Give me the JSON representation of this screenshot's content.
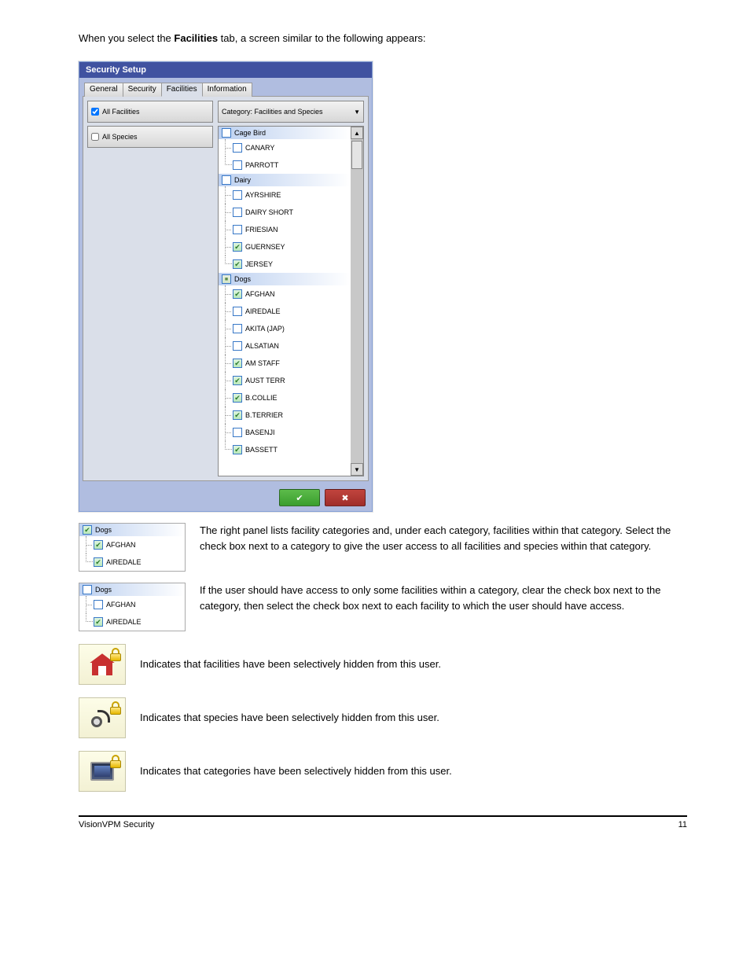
{
  "intro": {
    "part1": "When you select the ",
    "bold": "Facilities",
    "part2": " tab, a screen similar to the following appears:"
  },
  "dialog": {
    "title": "Security Setup",
    "tabs": [
      "General",
      "Security",
      "Facilities",
      "Information"
    ],
    "activeTab": 2,
    "leftFields": [
      {
        "label": "All Facilities",
        "checked": true
      },
      {
        "label": "All Species",
        "checked": false
      }
    ],
    "dropdown": "Category: Facilities and Species",
    "treeGroups": [
      {
        "header": "Cage Bird",
        "checked": false,
        "items": [
          {
            "label": "CANARY",
            "checked": false
          },
          {
            "label": "PARROTT",
            "checked": false
          }
        ]
      },
      {
        "header": "Dairy",
        "checked": false,
        "items": [
          {
            "label": "AYRSHIRE",
            "checked": false
          },
          {
            "label": "DAIRY SHORT",
            "checked": false
          },
          {
            "label": "FRIESIAN",
            "checked": false
          },
          {
            "label": "GUERNSEY",
            "checked": true
          },
          {
            "label": "JERSEY",
            "checked": true
          }
        ]
      },
      {
        "header": "Dogs",
        "checked": "mixed",
        "items": [
          {
            "label": "AFGHAN",
            "checked": true
          },
          {
            "label": "AIREDALE",
            "checked": false
          },
          {
            "label": "AKITA (JAP)",
            "checked": false
          },
          {
            "label": "ALSATIAN",
            "checked": false
          },
          {
            "label": "AM STAFF",
            "checked": true
          },
          {
            "label": "AUST TERR",
            "checked": true
          },
          {
            "label": "B.COLLIE",
            "checked": true
          },
          {
            "label": "B.TERRIER",
            "checked": true
          },
          {
            "label": "BASENJI",
            "checked": false
          },
          {
            "label": "BASSETT",
            "checked": true
          }
        ]
      }
    ]
  },
  "explain1": {
    "line1": "The right panel lists facility categories and, under each category, facilities within that category. Select the check box next to a category to give the user access to all facilities and species within that category.",
    "line2": "If the user should have access to only some facilities within a category, clear the check box next to the category, then select the check box next to each facility to which the user should have access."
  },
  "miniTree1": {
    "header": "Dogs",
    "headerChecked": true,
    "items": [
      {
        "label": "AFGHAN",
        "checked": true
      },
      {
        "label": "AIREDALE",
        "checked": true
      }
    ]
  },
  "miniTree2": {
    "header": "Dogs",
    "headerChecked": false,
    "items": [
      {
        "label": "AFGHAN",
        "checked": false
      },
      {
        "label": "AIREDALE",
        "checked": true
      }
    ]
  },
  "iconRows": [
    {
      "text": "Indicates that facilities have been selectively hidden from this user."
    },
    {
      "text": "Indicates that species have been selectively hidden from this user."
    },
    {
      "text": "Indicates that categories have been selectively hidden from this user."
    }
  ],
  "footer": {
    "left": "VisionVPM Security",
    "right": "11"
  }
}
